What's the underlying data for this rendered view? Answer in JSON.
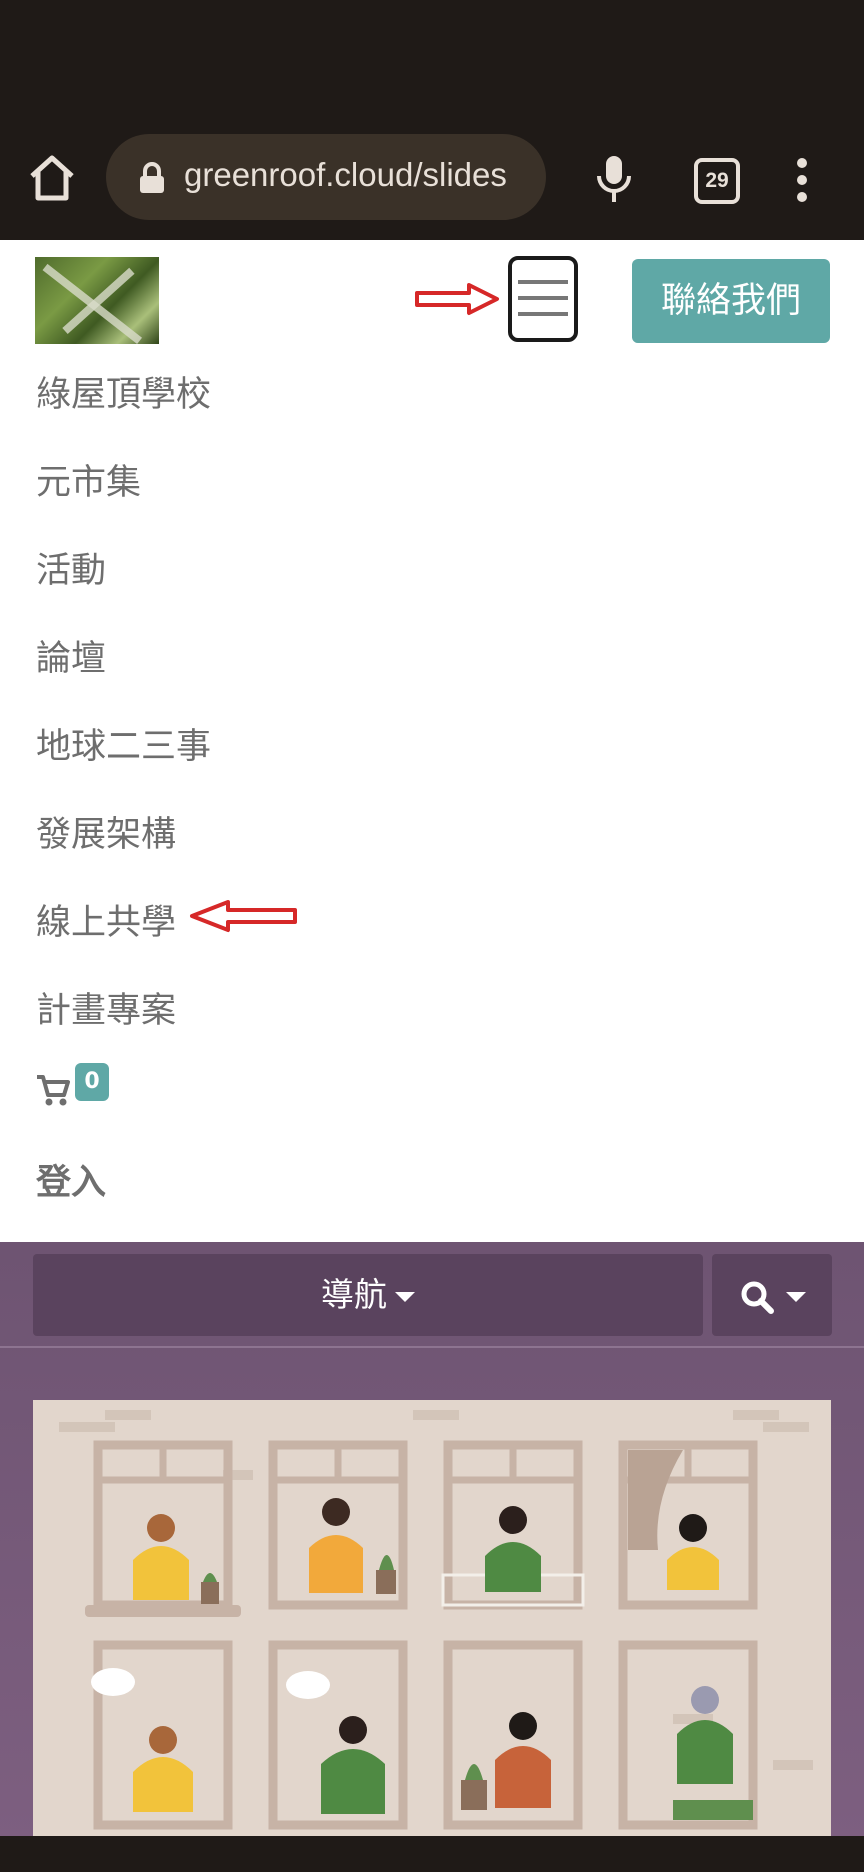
{
  "browser": {
    "url": "greenroof.cloud/slides",
    "tab_count": "29",
    "icons": [
      "home-icon",
      "lock-icon",
      "microphone-icon",
      "tabs-icon",
      "more-vert-icon"
    ]
  },
  "header": {
    "contact_button": "聯絡我們",
    "menu_toggle_icon": "hamburger-icon"
  },
  "menu": {
    "items": [
      {
        "label": "綠屋頂學校"
      },
      {
        "label": "元市集"
      },
      {
        "label": "活動"
      },
      {
        "label": "論壇"
      },
      {
        "label": "地球二三事"
      },
      {
        "label": "發展架構"
      },
      {
        "label": "線上共學"
      },
      {
        "label": "計畫專案"
      }
    ],
    "cart_count": "0",
    "login": "登入"
  },
  "subnav": {
    "nav_label": "導航"
  },
  "colors": {
    "accent": "#5fa8a6",
    "browser_bg": "#1f1a17",
    "purple_bg": "#7d5f80",
    "annotation_red": "#d62828"
  }
}
